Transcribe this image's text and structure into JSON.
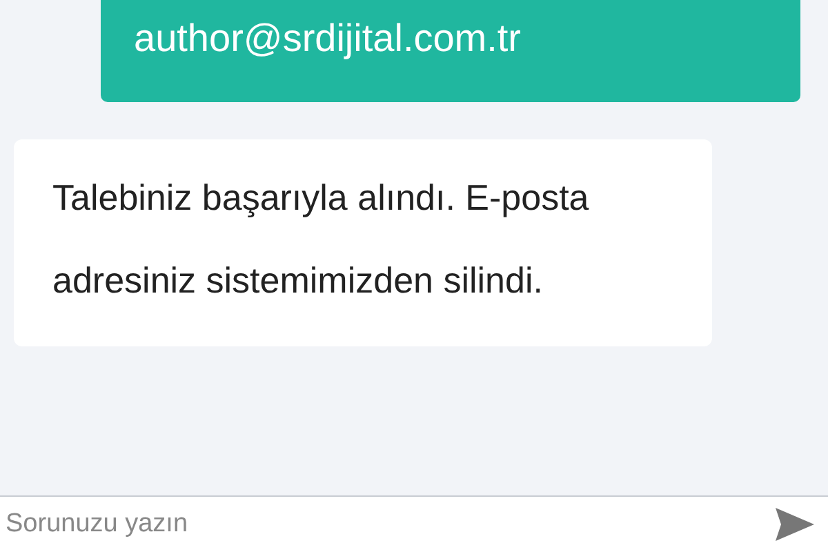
{
  "messages": [
    {
      "kind": "user",
      "text": "author@srdijital.com.tr"
    },
    {
      "kind": "bot",
      "text": "Talebiniz başarıyla alındı. E-posta adresiniz sistemimizden silindi."
    }
  ],
  "composer": {
    "placeholder": "Sorunuzu yazın"
  }
}
